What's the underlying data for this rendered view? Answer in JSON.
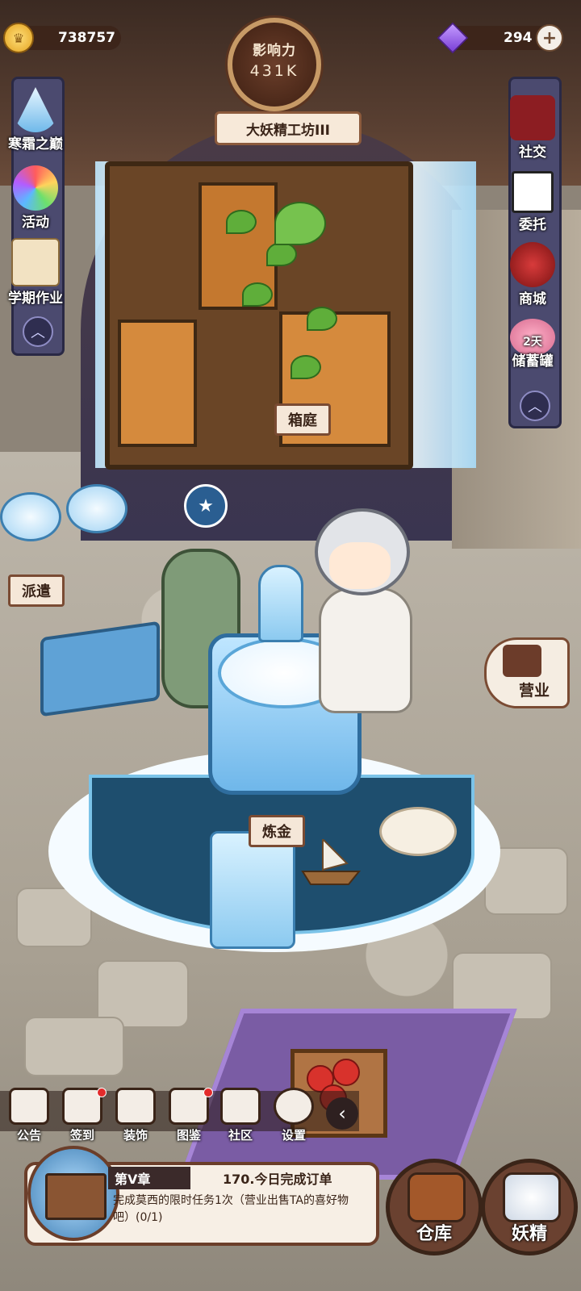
{
  "currencies": {
    "gold": "738757",
    "gems": "294"
  },
  "influence": {
    "label": "影响力",
    "value": "431K"
  },
  "workshop": {
    "name": "大妖精工坊III"
  },
  "left_menu": [
    {
      "label": "寒霜之巅",
      "icon": "ice-mountain-icon"
    },
    {
      "label": "活动",
      "icon": "rainbow-event-icon"
    },
    {
      "label": "学期作业",
      "icon": "scroll-homework-icon"
    }
  ],
  "right_menu": [
    {
      "label": "社交",
      "icon": "birds-social-icon"
    },
    {
      "label": "委托",
      "icon": "board-commission-icon"
    },
    {
      "label": "商城",
      "icon": "shop-icon"
    },
    {
      "label": "储蓄罐",
      "badge": "2天",
      "icon": "piggy-bank-icon"
    }
  ],
  "scene_labels": {
    "cabinet": "箱庭",
    "dispatch": "派遣",
    "alchemy": "炼金",
    "business": "营业"
  },
  "toolbar": [
    {
      "label": "公告",
      "icon": "notice-icon",
      "dot": false
    },
    {
      "label": "签到",
      "icon": "calendar-checkin-icon",
      "dot": true
    },
    {
      "label": "装饰",
      "icon": "castle-decor-icon",
      "dot": false
    },
    {
      "label": "图鉴",
      "icon": "book-codex-icon",
      "dot": true
    },
    {
      "label": "社区",
      "icon": "house-community-icon",
      "dot": false
    },
    {
      "label": "设置",
      "icon": "gear-icon",
      "dot": false
    }
  ],
  "quest": {
    "chapter": "第V章",
    "title": "170.今日完成订单",
    "description": "完成莫西的限时任务1次（营业出售TA的喜好物吧）(0/1)"
  },
  "bottom_buttons": {
    "warehouse": "仓库",
    "fairy": "妖精"
  },
  "colors": {
    "label_bg": "#f5e7d8",
    "label_border": "#7a4b33",
    "side_strip": "#4b4a6f",
    "ice": "#8ccaf0"
  }
}
